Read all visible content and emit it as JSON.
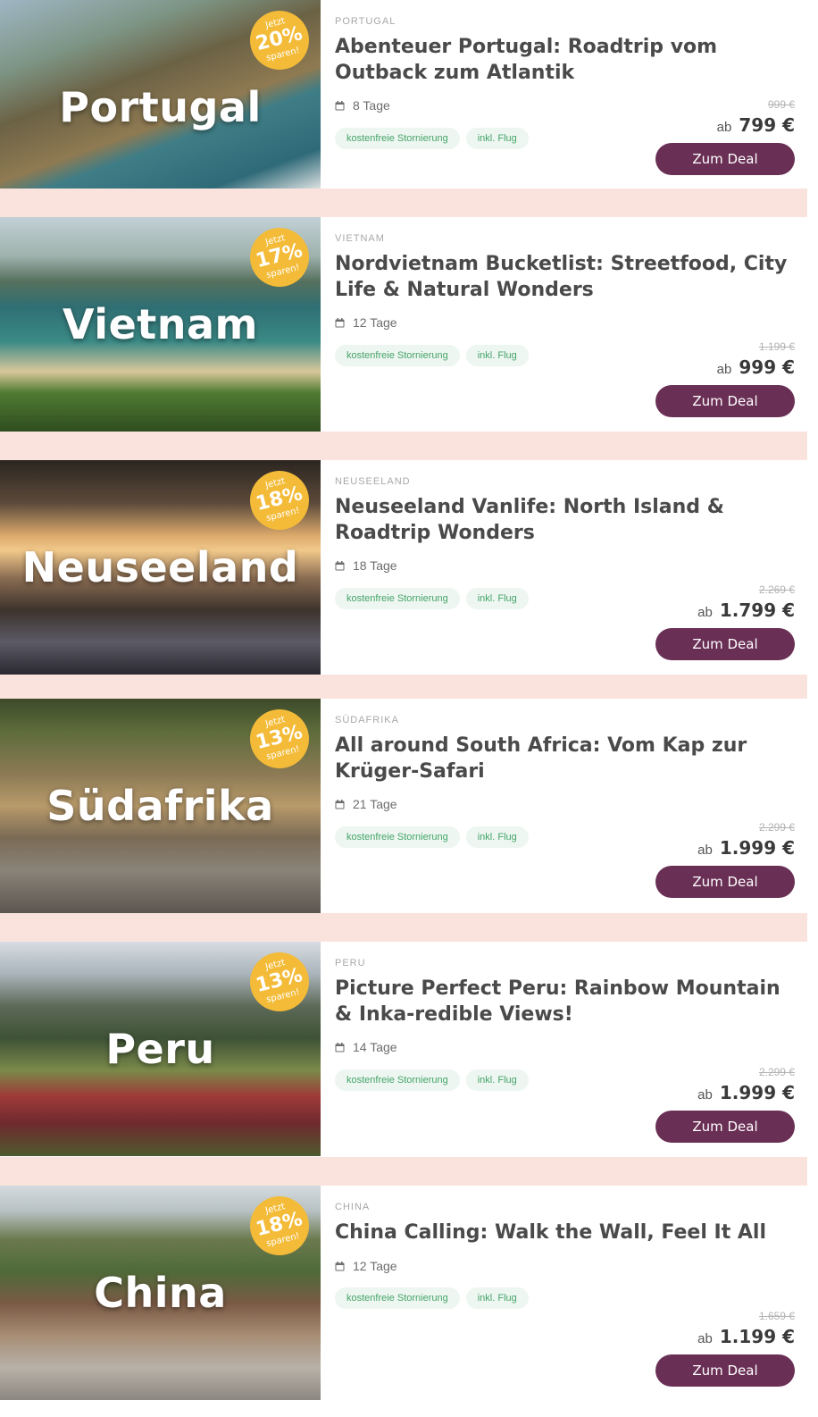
{
  "cards": [
    {
      "country": "PORTUGAL",
      "overlay": "Portugal",
      "badge": {
        "jetzt": "Jetzt",
        "percent": "20%",
        "sparen": "sparen!"
      },
      "title": "Abenteuer Portugal: Roadtrip vom Outback zum Atlantik",
      "duration": "8 Tage",
      "tags": [
        "kostenfreie Stornierung",
        "inkl. Flug"
      ],
      "old_price": "999 €",
      "price_prefix": "ab",
      "price": "799 €",
      "button": "Zum Deal"
    },
    {
      "country": "VIETNAM",
      "overlay": "Vietnam",
      "badge": {
        "jetzt": "Jetzt",
        "percent": "17%",
        "sparen": "sparen!"
      },
      "title": "Nordvietnam Bucketlist: Streetfood, City Life & Natural Wonders",
      "duration": "12 Tage",
      "tags": [
        "kostenfreie Stornierung",
        "inkl. Flug"
      ],
      "old_price": "1.199 €",
      "price_prefix": "ab",
      "price": "999 €",
      "button": "Zum Deal"
    },
    {
      "country": "NEUSEELAND",
      "overlay": "Neuseeland",
      "badge": {
        "jetzt": "Jetzt",
        "percent": "18%",
        "sparen": "sparen!"
      },
      "title": "Neuseeland Vanlife: North Island & Roadtrip Wonders",
      "duration": "18 Tage",
      "tags": [
        "kostenfreie Stornierung",
        "inkl. Flug"
      ],
      "old_price": "2.269 €",
      "price_prefix": "ab",
      "price": "1.799 €",
      "button": "Zum Deal"
    },
    {
      "country": "SÜDAFRIKA",
      "overlay": "Südafrika",
      "badge": {
        "jetzt": "Jetzt",
        "percent": "13%",
        "sparen": "sparen!"
      },
      "title": "All around South Africa: Vom Kap zur Krüger-Safari",
      "duration": "21 Tage",
      "tags": [
        "kostenfreie Stornierung",
        "inkl. Flug"
      ],
      "old_price": "2.299 €",
      "price_prefix": "ab",
      "price": "1.999 €",
      "button": "Zum Deal"
    },
    {
      "country": "PERU",
      "overlay": "Peru",
      "badge": {
        "jetzt": "Jetzt",
        "percent": "13%",
        "sparen": "sparen!"
      },
      "title": "Picture Perfect Peru: Rainbow Mountain & Inka-redible Views!",
      "duration": "14 Tage",
      "tags": [
        "kostenfreie Stornierung",
        "inkl. Flug"
      ],
      "old_price": "2.299 €",
      "price_prefix": "ab",
      "price": "1.999 €",
      "button": "Zum Deal"
    },
    {
      "country": "CHINA",
      "overlay": "China",
      "badge": {
        "jetzt": "Jetzt",
        "percent": "18%",
        "sparen": "sparen!"
      },
      "title": "China Calling: Walk the Wall, Feel It All",
      "duration": "12 Tage",
      "tags": [
        "kostenfreie Stornierung",
        "inkl. Flug"
      ],
      "old_price": "1.659 €",
      "price_prefix": "ab",
      "price": "1.199 €",
      "button": "Zum Deal"
    }
  ],
  "colors": {
    "separator": "#fbe3dd",
    "badge": "#f4bb38",
    "button": "#6a2f55",
    "tag_bg": "#edf6f0",
    "tag_text": "#45a46a"
  }
}
